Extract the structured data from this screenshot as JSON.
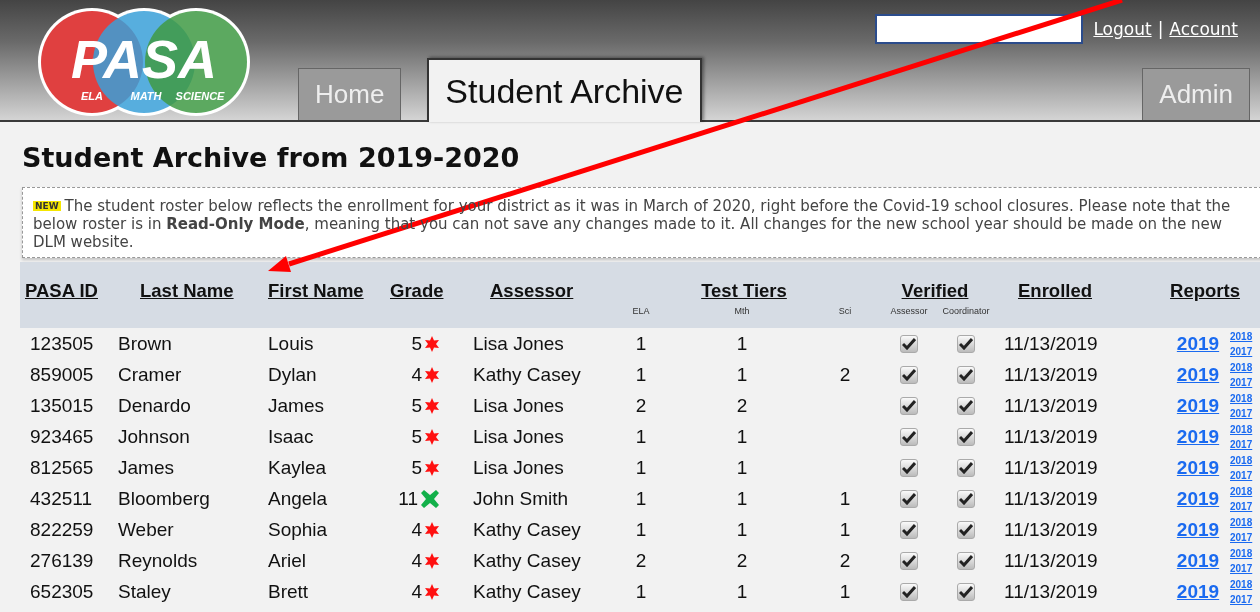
{
  "logo": {
    "text": "PASA",
    "subjects": [
      "ELA",
      "MATH",
      "SCIENCE"
    ]
  },
  "top_links": {
    "items": [
      "Logout",
      "Account"
    ],
    "separator": "|"
  },
  "tabs": [
    {
      "label": "Home",
      "selected": false
    },
    {
      "label": "Student Archive",
      "selected": true
    },
    {
      "label": "Admin",
      "selected": false
    }
  ],
  "page_title": "Student Archive from 2019-2020",
  "notice": {
    "badge": "NEW",
    "text": "The student roster below reflects the enrollment for your district as it was in March of 2020, right before the Covid-19 school closures. Please note that the below roster is in **Read-Only Mode**, meaning that you can not save any changes made to it. All changes for the new school year should be made on the new DLM website."
  },
  "table": {
    "columns": [
      {
        "label": "PASA ID"
      },
      {
        "label": "Last Name"
      },
      {
        "label": "First Name"
      },
      {
        "label": "Grade"
      },
      {
        "label": "Assessor"
      },
      {
        "label": "Test Tiers",
        "sub": [
          "ELA",
          "Mth",
          "Sci"
        ]
      },
      {
        "label": "Verified",
        "sub": [
          "Assessor",
          "Coordinator"
        ]
      },
      {
        "label": "Enrolled"
      },
      {
        "label": "Reports"
      }
    ],
    "rows": [
      {
        "pasa_id": "123505",
        "last_name": "Brown",
        "first_name": "Louis",
        "grade": "5",
        "grade_badge": {
          "kind": "star"
        },
        "assessor": "Lisa Jones",
        "ela": "1",
        "mth": "1",
        "sci": "",
        "assessor_verified": true,
        "coordinator_verified": true,
        "enrolled": "11/13/2019",
        "report": "2019",
        "older_reports": [
          "2018",
          "2017"
        ]
      },
      {
        "pasa_id": "859005",
        "last_name": "Cramer",
        "first_name": "Dylan",
        "grade": "4",
        "grade_badge": {
          "kind": "star"
        },
        "assessor": "Kathy Casey",
        "ela": "1",
        "mth": "1",
        "sci": "2",
        "assessor_verified": true,
        "coordinator_verified": true,
        "enrolled": "11/13/2019",
        "report": "2019",
        "older_reports": [
          "2018",
          "2017"
        ]
      },
      {
        "pasa_id": "135015",
        "last_name": "Denardo",
        "first_name": "James",
        "grade": "5",
        "grade_badge": {
          "kind": "star"
        },
        "assessor": "Lisa Jones",
        "ela": "2",
        "mth": "2",
        "sci": "",
        "assessor_verified": true,
        "coordinator_verified": true,
        "enrolled": "11/13/2019",
        "report": "2019",
        "older_reports": [
          "2018",
          "2017"
        ]
      },
      {
        "pasa_id": "923465",
        "last_name": "Johnson",
        "first_name": "Isaac",
        "grade": "5",
        "grade_badge": {
          "kind": "star"
        },
        "assessor": "Lisa Jones",
        "ela": "1",
        "mth": "1",
        "sci": "",
        "assessor_verified": true,
        "coordinator_verified": true,
        "enrolled": "11/13/2019",
        "report": "2019",
        "older_reports": [
          "2018",
          "2017"
        ]
      },
      {
        "pasa_id": "812565",
        "last_name": "James",
        "first_name": "Kaylea",
        "grade": "5",
        "grade_badge": {
          "kind": "star"
        },
        "assessor": "Lisa Jones",
        "ela": "1",
        "mth": "1",
        "sci": "",
        "assessor_verified": true,
        "coordinator_verified": true,
        "enrolled": "11/13/2019",
        "report": "2019",
        "older_reports": [
          "2018",
          "2017"
        ]
      },
      {
        "pasa_id": "432511",
        "last_name": "Bloomberg",
        "first_name": "Angela",
        "grade": "11",
        "grade_badge": {
          "kind": "cross"
        },
        "assessor": "John Smith",
        "ela": "1",
        "mth": "1",
        "sci": "1",
        "assessor_verified": true,
        "coordinator_verified": true,
        "enrolled": "11/13/2019",
        "report": "2019",
        "older_reports": [
          "2018",
          "2017"
        ]
      },
      {
        "pasa_id": "822259",
        "last_name": "Weber",
        "first_name": "Sophia",
        "grade": "4",
        "grade_badge": {
          "kind": "star"
        },
        "assessor": "Kathy Casey",
        "ela": "1",
        "mth": "1",
        "sci": "1",
        "assessor_verified": true,
        "coordinator_verified": true,
        "enrolled": "11/13/2019",
        "report": "2019",
        "older_reports": [
          "2018",
          "2017"
        ]
      },
      {
        "pasa_id": "276139",
        "last_name": "Reynolds",
        "first_name": "Ariel",
        "grade": "4",
        "grade_badge": {
          "kind": "star"
        },
        "assessor": "Kathy Casey",
        "ela": "2",
        "mth": "2",
        "sci": "2",
        "assessor_verified": true,
        "coordinator_verified": true,
        "enrolled": "11/13/2019",
        "report": "2019",
        "older_reports": [
          "2018",
          "2017"
        ]
      },
      {
        "pasa_id": "652305",
        "last_name": "Staley",
        "first_name": "Brett",
        "grade": "4",
        "grade_badge": {
          "kind": "star"
        },
        "assessor": "Kathy Casey",
        "ela": "1",
        "mth": "1",
        "sci": "1",
        "assessor_verified": true,
        "coordinator_verified": true,
        "enrolled": "11/13/2019",
        "report": "2019",
        "older_reports": [
          "2018",
          "2017"
        ]
      }
    ]
  }
}
